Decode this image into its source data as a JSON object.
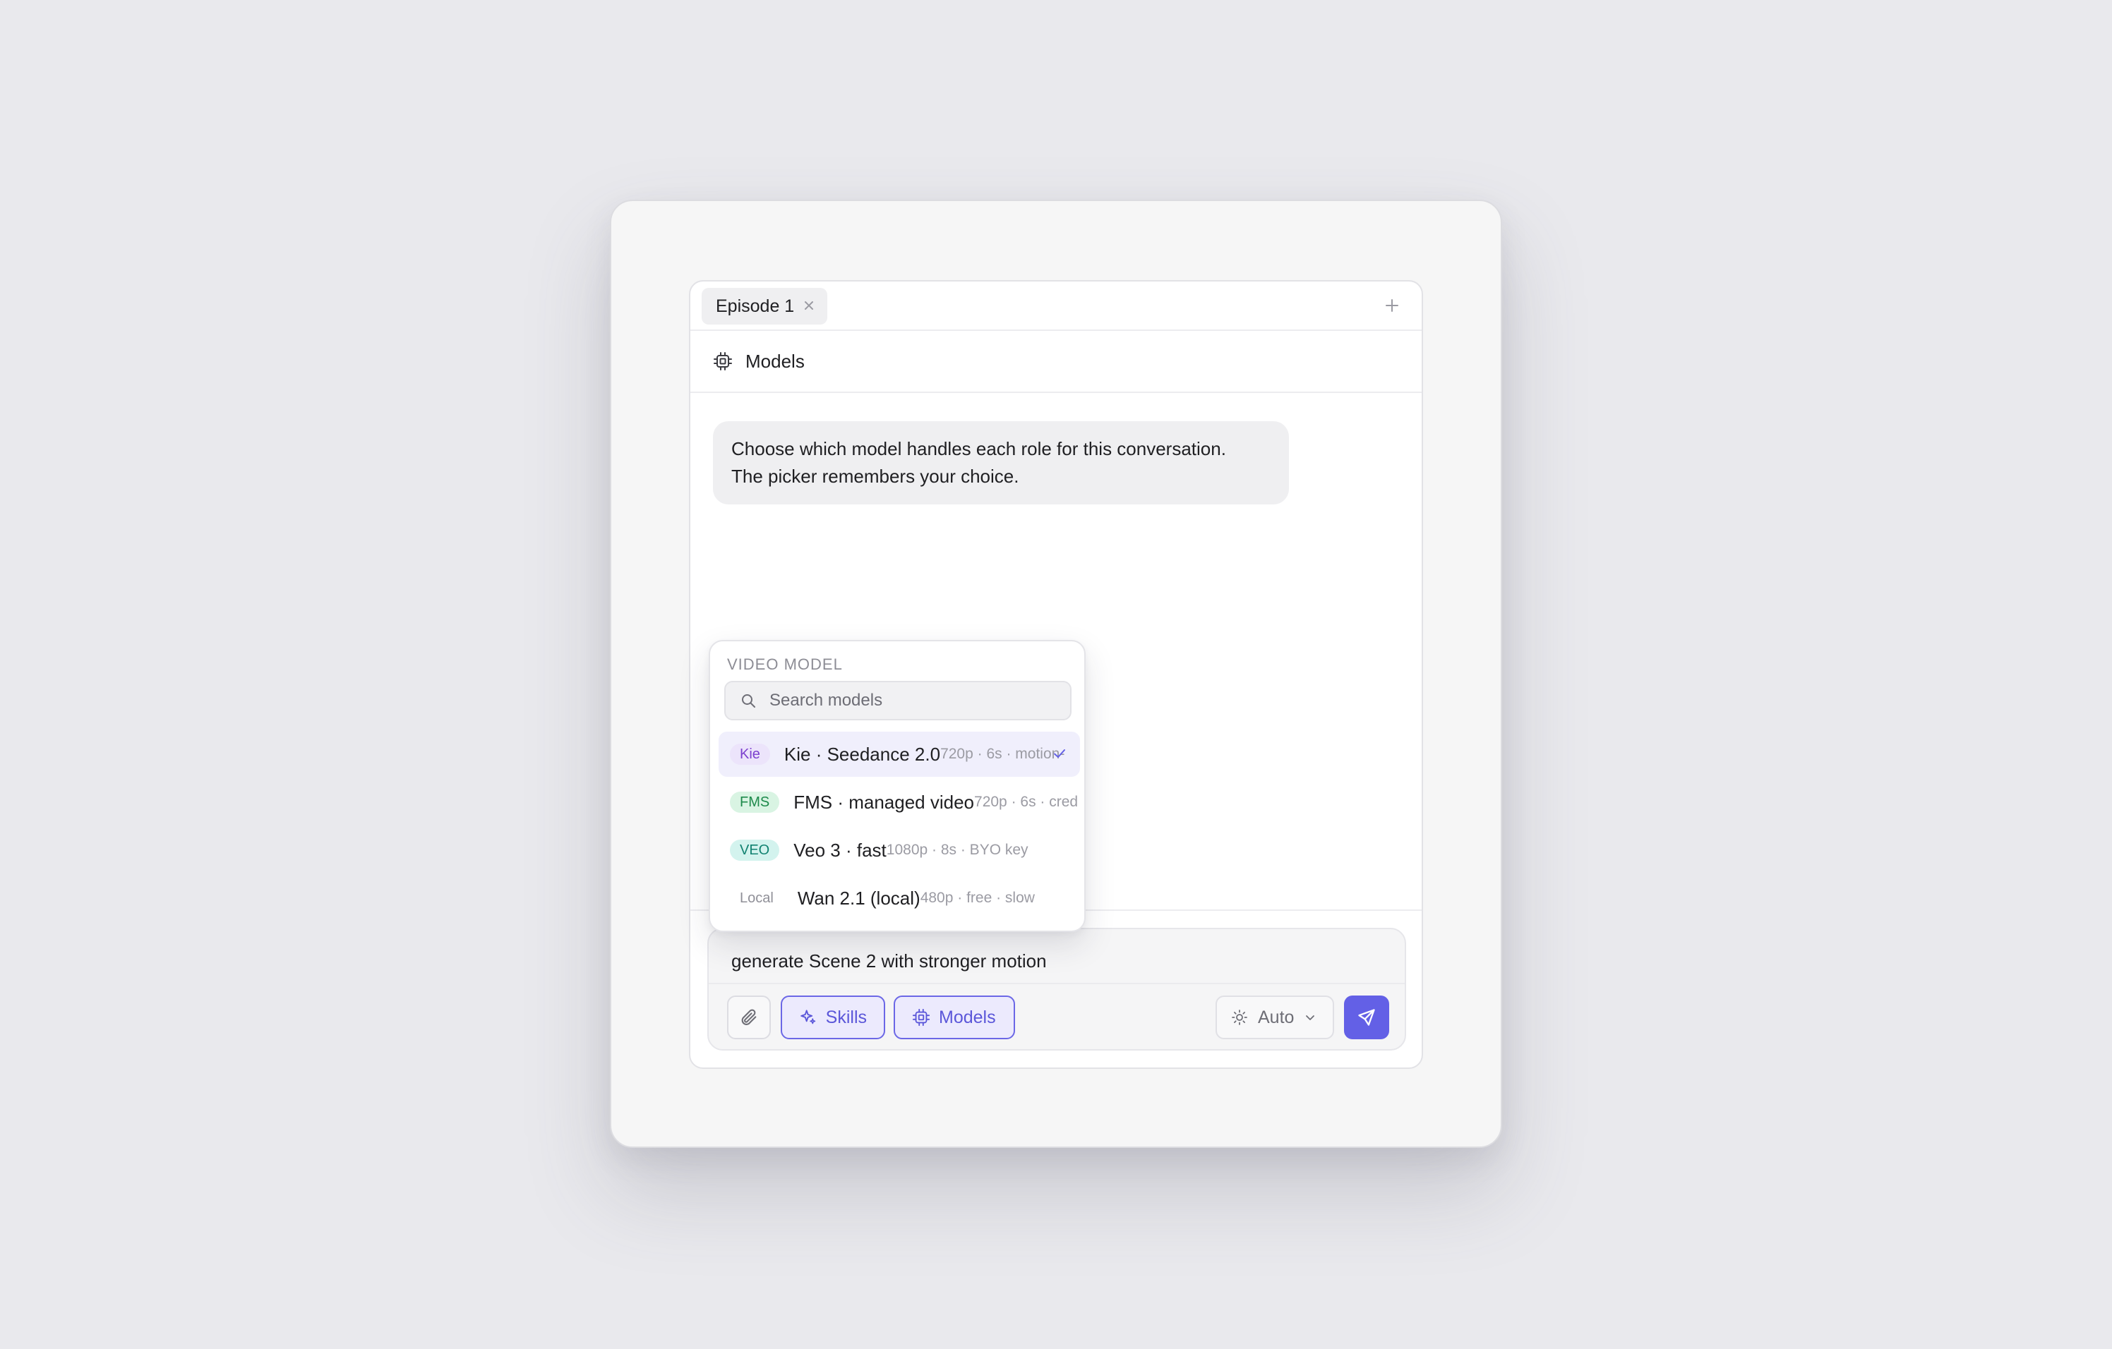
{
  "tabs": [
    {
      "label": "Episode 1",
      "active": true
    }
  ],
  "header": {
    "title": "Models",
    "icon": "chip-icon"
  },
  "message": {
    "line1": "Choose which model handles each role for this conversation.",
    "line2": "The picker remembers your choice."
  },
  "picker": {
    "title": "VIDEO MODEL",
    "search_placeholder": "Search models",
    "items": [
      {
        "badge": "Kie",
        "name": "Kie · Seedance 2.0",
        "meta": "720p · 6s · motion-",
        "selected": true
      },
      {
        "badge": "FMS",
        "name": "FMS · managed video",
        "meta": "720p · 6s · cred",
        "selected": false
      },
      {
        "badge": "VEO",
        "name": "Veo 3 · fast",
        "meta": "1080p · 8s · BYO key",
        "selected": false
      },
      {
        "badge": "Local",
        "name": "Wan 2.1 (local)",
        "meta": "480p · free · slow",
        "selected": false
      }
    ]
  },
  "composer": {
    "text": "generate Scene 2 with stronger motion",
    "skills_label": "Skills",
    "models_label": "Models",
    "mode_label": "Auto"
  },
  "colors": {
    "accent": "#6360e6",
    "badge_kie": "#7b3fce",
    "badge_fms": "#1d8a4b",
    "badge_veo": "#128271"
  }
}
